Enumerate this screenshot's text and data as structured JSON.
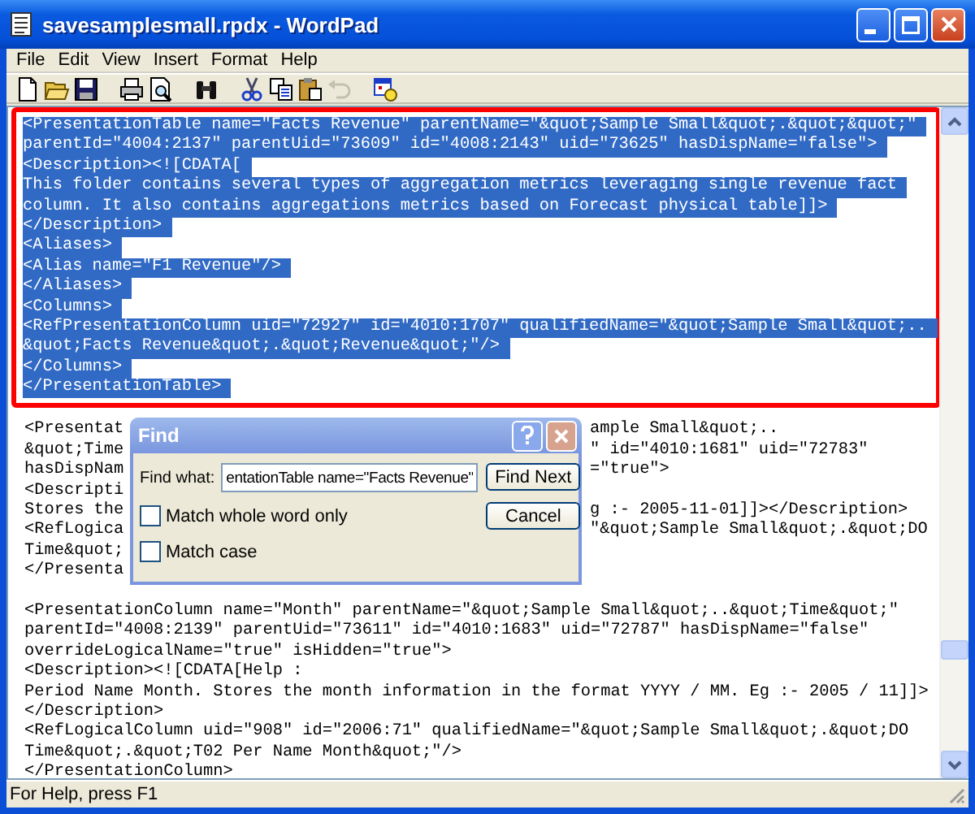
{
  "window": {
    "title": "savesamplesmall.rpdx - WordPad"
  },
  "menu": [
    {
      "label": "File"
    },
    {
      "label": "Edit"
    },
    {
      "label": "View"
    },
    {
      "label": "Insert"
    },
    {
      "label": "Format"
    },
    {
      "label": "Help"
    }
  ],
  "toolbar": [
    {
      "kind": "new",
      "disabled": false
    },
    {
      "kind": "open",
      "disabled": false
    },
    {
      "kind": "save",
      "disabled": false
    },
    {
      "kind": "print",
      "disabled": false
    },
    {
      "kind": "preview",
      "disabled": false
    },
    {
      "kind": "find",
      "disabled": false
    },
    {
      "kind": "cut",
      "disabled": false
    },
    {
      "kind": "copy",
      "disabled": false
    },
    {
      "kind": "paste",
      "disabled": false
    },
    {
      "kind": "undo",
      "disabled": true
    },
    {
      "kind": "datetime",
      "disabled": false
    }
  ],
  "document": {
    "blocks": [
      {
        "outlined": true,
        "lines": [
          {
            "text": "<PresentationTable name=\"Facts Revenue\" parentName=\"&quot;Sample Small&quot;.&quot;&quot;\"",
            "selected": true
          },
          {
            "text": "parentId=\"4004:2137\" parentUid=\"73609\" id=\"4008:2143\" uid=\"73625\" hasDispName=\"false\">",
            "selected": true
          },
          {
            "text": "<Description><![CDATA[",
            "selected": true
          },
          {
            "text": "This folder contains several types of aggregation metrics leveraging single revenue fact",
            "selected": true
          },
          {
            "text": "column. It also contains aggregations metrics based on Forecast physical table]]>",
            "selected": true
          },
          {
            "text": "</Description>",
            "selected": true
          },
          {
            "text": "<Aliases>",
            "selected": true
          },
          {
            "text": "<Alias name=\"F1 Revenue\"/>",
            "selected": true
          },
          {
            "text": "</Aliases>",
            "selected": true
          },
          {
            "text": "<Columns>",
            "selected": true
          },
          {
            "text": "<RefPresentationColumn uid=\"72927\" id=\"4010:1707\" qualifiedName=\"&quot;Sample Small&quot;..",
            "selected": true
          },
          {
            "text": "&quot;Facts Revenue&quot;.&quot;Revenue&quot;\"/>",
            "selected": true
          },
          {
            "text": "</Columns>",
            "selected": true
          },
          {
            "text": "</PresentationTable>",
            "selected": true
          }
        ]
      },
      {
        "outlined": false,
        "lines": [
          {
            "text": "<Presentat",
            "after_dialog": "ample Small&quot;..",
            "selected": false
          },
          {
            "text": "&quot;Time",
            "after_dialog": "\" id=\"4010:1681\" uid=\"72783\"",
            "selected": false
          },
          {
            "text": "hasDispNam",
            "after_dialog": "=\"true\">",
            "selected": false
          },
          {
            "text": "<Descripti",
            "selected": false
          },
          {
            "text": "Stores the",
            "after_dialog": "g :- 2005-11-01]]></Description>",
            "selected": false
          },
          {
            "text": "<RefLogica",
            "after_dialog": "\"&quot;Sample Small&quot;.&quot;DO",
            "selected": false
          },
          {
            "text": "Time&quot;",
            "selected": false
          },
          {
            "text": "</Presenta",
            "selected": false
          }
        ]
      },
      {
        "outlined": false,
        "lines": [
          {
            "text": "<PresentationColumn name=\"Month\" parentName=\"&quot;Sample Small&quot;..&quot;Time&quot;\"",
            "selected": false
          },
          {
            "text": "parentId=\"4008:2139\" parentUid=\"73611\" id=\"4010:1683\" uid=\"72787\" hasDispName=\"false\"",
            "selected": false
          },
          {
            "text": "overrideLogicalName=\"true\" isHidden=\"true\">",
            "selected": false
          },
          {
            "text": "<Description><![CDATA[Help :",
            "selected": false
          },
          {
            "text": "Period Name Month. Stores the month information in the format YYYY / MM. Eg :- 2005 / 11]]>",
            "selected": false
          },
          {
            "text": "</Description>",
            "selected": false
          },
          {
            "text": "<RefLogicalColumn uid=\"908\" id=\"2006:71\" qualifiedName=\"&quot;Sample Small&quot;.&quot;DO",
            "selected": false
          },
          {
            "text": "Time&quot;.&quot;T02 Per Name Month&quot;\"/>",
            "selected": false
          },
          {
            "text": "</PresentationColumn>",
            "selected": false
          }
        ]
      }
    ]
  },
  "find_dialog": {
    "title": "Find",
    "field_label": "Find what:",
    "value": "entationTable name=\"Facts Revenue\"",
    "options": [
      {
        "label": "Match whole word only",
        "checked": false
      },
      {
        "label": "Match case",
        "checked": false
      }
    ],
    "buttons": [
      {
        "label": "Find Next"
      },
      {
        "label": "Cancel"
      }
    ]
  },
  "status_bar": {
    "text": "For Help, press F1"
  }
}
